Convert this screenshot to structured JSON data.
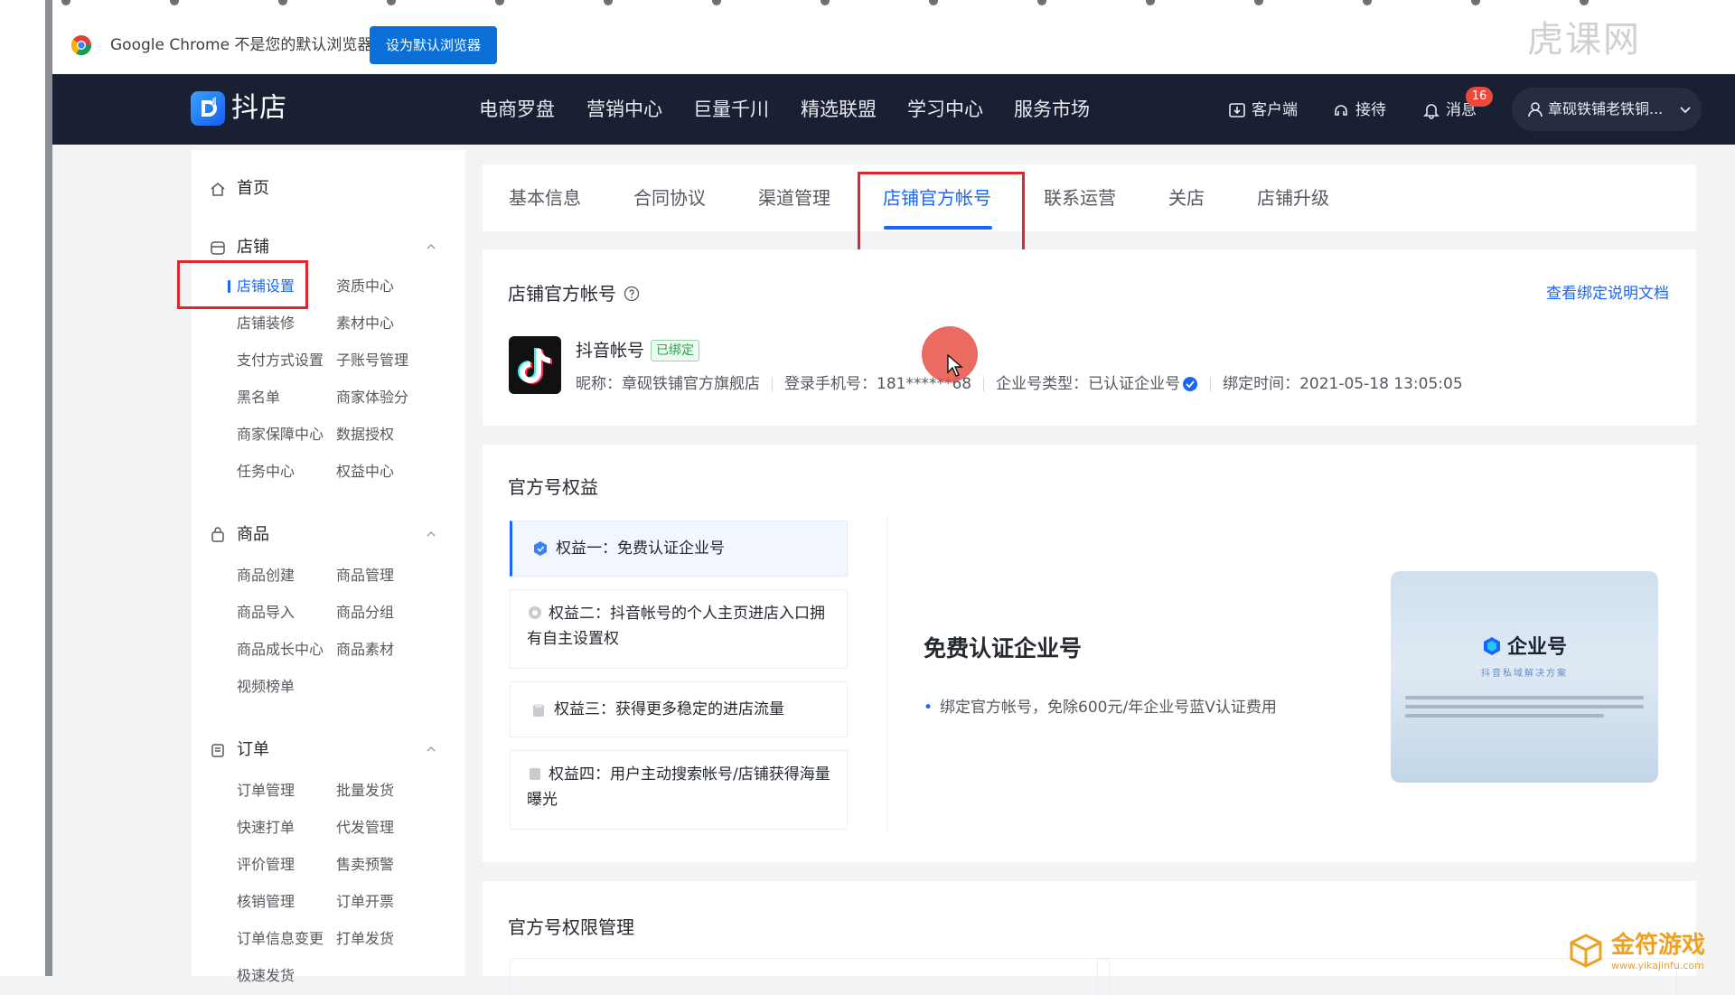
{
  "browser": {
    "default_prompt": "Google Chrome 不是您的默认浏览器",
    "default_button": "设为默认浏览器"
  },
  "top_nav": {
    "logo_text": "抖店",
    "items": [
      "电商罗盘",
      "营销中心",
      "巨量千川",
      "精选联盟",
      "学习中心",
      "服务市场"
    ],
    "client_label": "客户端",
    "reception_label": "接待",
    "messages_label": "消息",
    "messages_badge": "16",
    "user_name": "章砚铁铺老铁铜..."
  },
  "sidebar": {
    "home": "首页",
    "shop": {
      "label": "店铺",
      "items": [
        "店铺设置",
        "资质中心",
        "店铺装修",
        "素材中心",
        "支付方式设置",
        "子账号管理",
        "黑名单",
        "商家体验分",
        "商家保障中心",
        "数据授权",
        "任务中心",
        "权益中心"
      ]
    },
    "product": {
      "label": "商品",
      "items": [
        "商品创建",
        "商品管理",
        "商品导入",
        "商品分组",
        "商品成长中心",
        "商品素材",
        "视频榜单"
      ]
    },
    "order": {
      "label": "订单",
      "items": [
        "订单管理",
        "批量发货",
        "快速打单",
        "代发管理",
        "评价管理",
        "售卖预警",
        "核销管理",
        "订单开票",
        "订单信息变更",
        "打单发货",
        "极速发货"
      ]
    }
  },
  "tabs": [
    "基本信息",
    "合同协议",
    "渠道管理",
    "店铺官方帐号",
    "联系运营",
    "关店",
    "店铺升级"
  ],
  "account": {
    "title": "店铺官方帐号",
    "doc_link": "查看绑定说明文档",
    "name": "抖音帐号",
    "bound_tag": "已绑定",
    "nickname": "昵称：章砚铁铺官方旗舰店",
    "phone": "登录手机号：181******68",
    "type": "企业号类型：已认证企业号",
    "bind_time": "绑定时间：2021-05-18 13:05:05"
  },
  "benefits": {
    "title": "官方号权益",
    "items": [
      "权益一：免费认证企业号",
      "权益二：抖音帐号的个人主页进店入口拥有自主设置权",
      "权益三：获得更多稳定的进店流量",
      "权益四：用户主动搜索帐号/店铺获得海量曝光"
    ],
    "detail_title": "免费认证企业号",
    "detail_desc": "绑定官方帐号，免除600元/年企业号蓝V认证费用",
    "promo_brand": "企业号",
    "promo_sub": "抖音私域解决方案"
  },
  "permissions": {
    "title": "官方号权限管理"
  },
  "watermarks": {
    "top": "虎课网",
    "bottom": "金符游戏",
    "bottom_url": "www.yikajinfu.com"
  },
  "colors": {
    "accent": "#1966ff",
    "nav_bg": "#1a2033",
    "highlight_red": "#e0262c",
    "badge_red": "#f0473b",
    "bound_green": "#2fa34f"
  }
}
